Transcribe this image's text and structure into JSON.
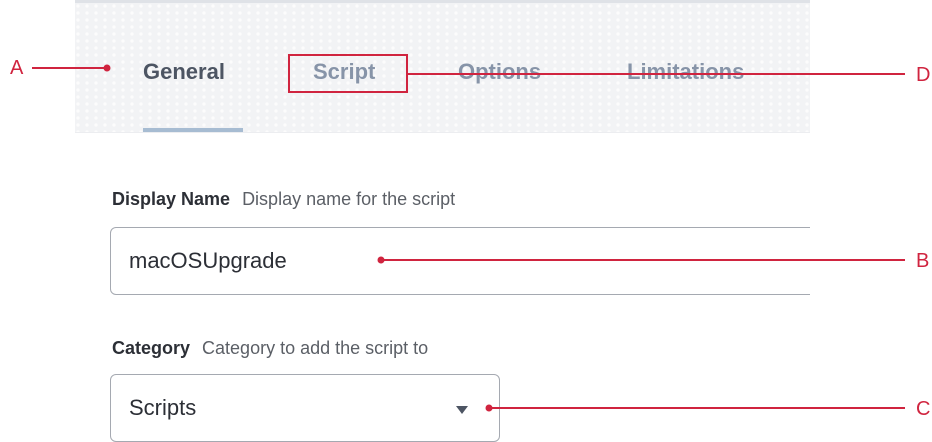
{
  "tabs": [
    {
      "label": "General",
      "active": true
    },
    {
      "label": "Script",
      "active": false
    },
    {
      "label": "Options",
      "active": false
    },
    {
      "label": "Limitations",
      "active": false
    }
  ],
  "display_name": {
    "label": "Display Name",
    "hint": "Display name for the script",
    "value": "macOSUpgrade"
  },
  "category": {
    "label": "Category",
    "hint": "Category to add the script to",
    "value": "Scripts"
  },
  "callouts": {
    "a": "A",
    "b": "B",
    "c": "C",
    "d": "D"
  },
  "colors": {
    "annotation": "#d0243f",
    "active_tab_underline": "#a7bcd2"
  }
}
